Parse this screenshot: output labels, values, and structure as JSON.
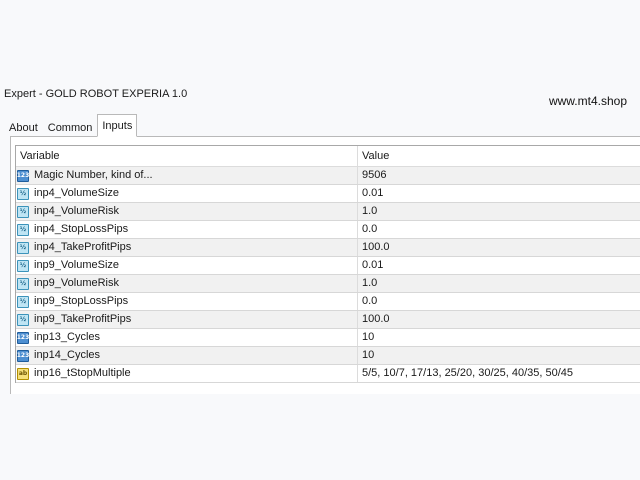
{
  "window": {
    "title": "Expert - GOLD ROBOT EXPERIA 1.0",
    "watermark": "www.mt4.shop"
  },
  "tabs": [
    {
      "label": "About",
      "active": false
    },
    {
      "label": "Common",
      "active": false
    },
    {
      "label": "Inputs",
      "active": true
    }
  ],
  "table": {
    "columns": [
      "Variable",
      "Value"
    ],
    "rows": [
      {
        "icon": "int-icon",
        "variable": "Magic Number, kind of...",
        "value": "9506"
      },
      {
        "icon": "float-icon",
        "variable": "inp4_VolumeSize",
        "value": "0.01"
      },
      {
        "icon": "float-icon",
        "variable": "inp4_VolumeRisk",
        "value": "1.0"
      },
      {
        "icon": "float-icon",
        "variable": "inp4_StopLossPips",
        "value": "0.0"
      },
      {
        "icon": "float-icon",
        "variable": "inp4_TakeProfitPips",
        "value": "100.0"
      },
      {
        "icon": "float-icon",
        "variable": "inp9_VolumeSize",
        "value": "0.01"
      },
      {
        "icon": "float-icon",
        "variable": "inp9_VolumeRisk",
        "value": "1.0"
      },
      {
        "icon": "float-icon",
        "variable": "inp9_StopLossPips",
        "value": "0.0"
      },
      {
        "icon": "float-icon",
        "variable": "inp9_TakeProfitPips",
        "value": "100.0"
      },
      {
        "icon": "int-icon",
        "variable": "inp13_Cycles",
        "value": "10"
      },
      {
        "icon": "int-icon",
        "variable": "inp14_Cycles",
        "value": "10"
      },
      {
        "icon": "string-icon",
        "variable": "inp16_tStopMultiple",
        "value": "5/5, 10/7, 17/13,  25/20, 30/25,  40/35, 50/45"
      }
    ]
  },
  "icons": {
    "int-icon": "123",
    "float-icon": "½",
    "string-icon": "ab"
  }
}
